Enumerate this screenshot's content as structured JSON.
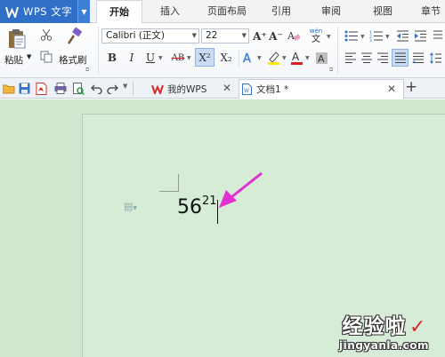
{
  "app": {
    "name": "WPS 文字"
  },
  "menu": {
    "tabs": [
      {
        "label": "开始"
      },
      {
        "label": "插入"
      },
      {
        "label": "页面布局"
      },
      {
        "label": "引用"
      },
      {
        "label": "审阅"
      },
      {
        "label": "视图"
      },
      {
        "label": "章节"
      }
    ]
  },
  "ribbon": {
    "paste_label": "粘贴",
    "format_painter_label": "格式刷",
    "font_name": "Calibri (正文)",
    "font_size": "22",
    "bold": "B",
    "italic": "I",
    "underline": "U",
    "strikethrough": "AB",
    "superscript": "X²",
    "subscript": "X₂",
    "font_increase": "A⁺",
    "font_decrease": "A⁻",
    "phonetic": "wén",
    "phonetic_sub": "文"
  },
  "tabs": {
    "items": [
      {
        "label": "我的WPS"
      },
      {
        "label": "文档1 *"
      }
    ]
  },
  "document": {
    "base": "56",
    "superscript": "21"
  },
  "watermark": {
    "cn": "经验啦",
    "en": "jingyanla.com",
    "check": "✓"
  },
  "colors": {
    "accent": "#2f6fc7",
    "annotation_arrow": "#e030d0",
    "document_bg": "#cfe6cf"
  }
}
